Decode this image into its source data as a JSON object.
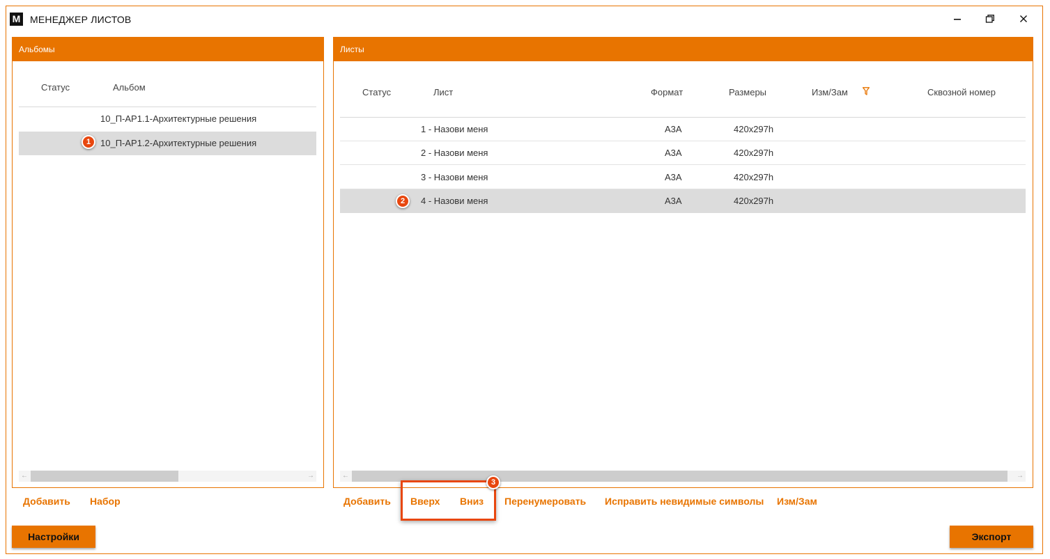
{
  "window": {
    "logo": "M",
    "title": "МЕНЕДЖЕР ЛИСТОВ",
    "controls": [
      "minimize-icon",
      "restore-icon",
      "close-icon"
    ]
  },
  "albums_panel": {
    "header": "Альбомы",
    "columns": [
      "Статус",
      "Альбом"
    ],
    "rows": [
      {
        "status": "",
        "album": "10_П-АР1.1-Архитектурные решения",
        "selected": false
      },
      {
        "status": "",
        "album": "10_П-АР1.2-Архитектурные решения",
        "selected": true
      }
    ],
    "actions": [
      "Добавить",
      "Набор"
    ]
  },
  "sheets_panel": {
    "header": "Листы",
    "columns": [
      "Статус",
      "Лист",
      "Формат",
      "Размеры",
      "Изм/Зам",
      "Сквозной номер"
    ],
    "rows": [
      {
        "status": "",
        "sheet": "1 - Назови меня",
        "format": "А3А",
        "size": "420x297h",
        "rev": "",
        "number": "",
        "selected": false
      },
      {
        "status": "",
        "sheet": "2 - Назови меня",
        "format": "А3А",
        "size": "420x297h",
        "rev": "",
        "number": "",
        "selected": false
      },
      {
        "status": "",
        "sheet": "3 - Назови меня",
        "format": "А3А",
        "size": "420x297h",
        "rev": "",
        "number": "",
        "selected": false
      },
      {
        "status": "",
        "sheet": "4 - Назови меня",
        "format": "А3А",
        "size": "420x297h",
        "rev": "",
        "number": "",
        "selected": true
      }
    ],
    "actions": [
      "Добавить",
      "Вверх",
      "Вниз",
      "Перенумеровать",
      "Исправить невидимые символы",
      "Изм/Зам"
    ]
  },
  "annotations": [
    "1",
    "2",
    "3"
  ],
  "footer": {
    "settings": "Настройки",
    "export": "Экспорт"
  },
  "colors": {
    "accent": "#e87400",
    "badge": "#e8470f",
    "selected_row": "#dcdcdc"
  }
}
